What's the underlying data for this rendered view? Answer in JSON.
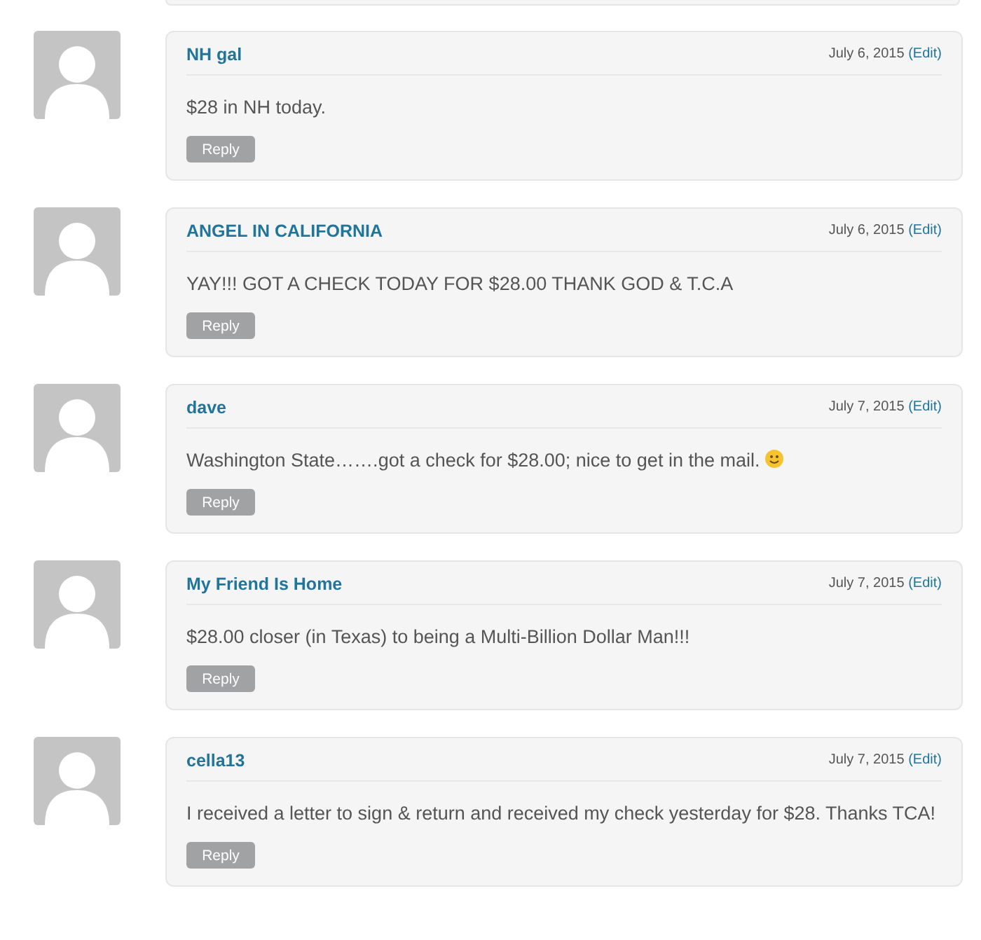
{
  "comments": [
    {
      "author": "NH gal",
      "date": "July 6, 2015",
      "edit": "(Edit)",
      "text": "$28 in NH today.",
      "smiley": false,
      "reply": "Reply"
    },
    {
      "author": "ANGEL IN CALIFORNIA",
      "date": "July 6, 2015",
      "edit": "(Edit)",
      "text": "YAY!!! GOT A CHECK TODAY FOR $28.00 THANK GOD & T.C.A",
      "smiley": false,
      "reply": "Reply"
    },
    {
      "author": "dave",
      "date": "July 7, 2015",
      "edit": "(Edit)",
      "text": "Washington State…….got a check for $28.00; nice to get in the mail.",
      "smiley": true,
      "reply": "Reply"
    },
    {
      "author": "My Friend Is Home",
      "date": "July 7, 2015",
      "edit": "(Edit)",
      "text": "$28.00 closer (in Texas) to being a Multi-Billion Dollar Man!!!",
      "smiley": false,
      "reply": "Reply"
    },
    {
      "author": "cella13",
      "date": "July 7, 2015",
      "edit": "(Edit)",
      "text": "I received a letter to sign & return and received my check yesterday for $28. Thanks TCA!",
      "smiley": false,
      "reply": "Reply"
    }
  ]
}
